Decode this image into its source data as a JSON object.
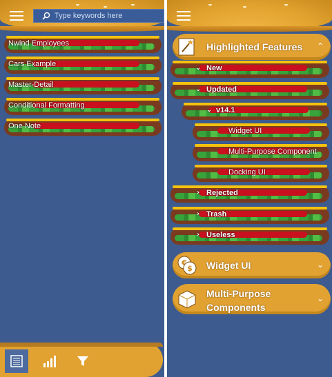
{
  "left": {
    "search": {
      "placeholder": "Type keywords here"
    },
    "items": [
      {
        "label": "Nwind Employees"
      },
      {
        "label": "Cars Example"
      },
      {
        "label": "Master-Detail"
      },
      {
        "label": "Conditional Formatting"
      },
      {
        "label": "One Note"
      }
    ],
    "footer_tabs": [
      {
        "icon": "list-icon",
        "active": true
      },
      {
        "icon": "bar-chart-icon",
        "active": false
      },
      {
        "icon": "filter-icon",
        "active": false
      }
    ]
  },
  "right": {
    "groups": [
      {
        "title": "Highlighted Features",
        "icon": "magic-wand-icon",
        "expanded": true
      },
      {
        "title": "Widget UI",
        "icon": "coins-icon",
        "expanded": false
      },
      {
        "title_line1": "Multi-Purpose",
        "title_line2": "Components",
        "icon": "cube-icon",
        "expanded": false
      }
    ],
    "tree": {
      "new": "New",
      "updated": "Updated",
      "v141": "v14.1",
      "widget_ui": "Widget UI",
      "multi_purpose": "Multi-Purpose Component",
      "docking_ui": "Docking UI",
      "rejected": "Rejected",
      "trash": "Trash",
      "useless": "Useless"
    }
  },
  "colors": {
    "background": "#3d5b8e",
    "bun": "#e2a232",
    "lettuce": "#37a33a",
    "tomato": "#c8101e",
    "cheese": "#f5c20f",
    "meat": "#7a3a1f"
  }
}
